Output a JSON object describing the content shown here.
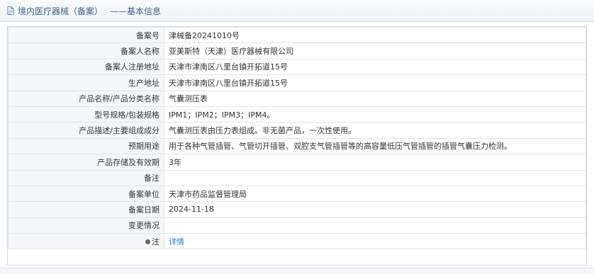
{
  "header": {
    "title": "境内医疗器械（备案）",
    "subtitle": "——基本信息"
  },
  "fields": [
    {
      "label": "备案号",
      "value": "津械备20241010号"
    },
    {
      "label": "备案人名称",
      "value": "亚美斯特（天津）医疗器械有限公司"
    },
    {
      "label": "备案人注册地址",
      "value": "天津市津南区八里台镇开拓道15号"
    },
    {
      "label": "生产地址",
      "value": "天津市津南区八里台镇开拓道15号"
    },
    {
      "label": "产品名称/产品分类名称",
      "value": "气囊测压表"
    },
    {
      "label": "型号规格/包装规格",
      "value": "IPM1；IPM2；IPM3；IPM4。"
    },
    {
      "label": "产品描述/主要组成成分",
      "value": "气囊测压表由压力表组成。非无菌产品，一次性使用。"
    },
    {
      "label": "预期用途",
      "value": "用于各种气管插管、气管切开插管、双腔支气管插管等的高容量低压气管插管的插管气囊压力检测。"
    },
    {
      "label": "产品存储及有效期",
      "value": "3年"
    },
    {
      "label": "备注",
      "value": ""
    },
    {
      "label": "备案单位",
      "value": "天津市药品监督管理局"
    },
    {
      "label": "备案日期",
      "value": "2024-11-18"
    },
    {
      "label": "变更情况",
      "value": ""
    }
  ],
  "note": {
    "label": "注",
    "link": "详情"
  }
}
